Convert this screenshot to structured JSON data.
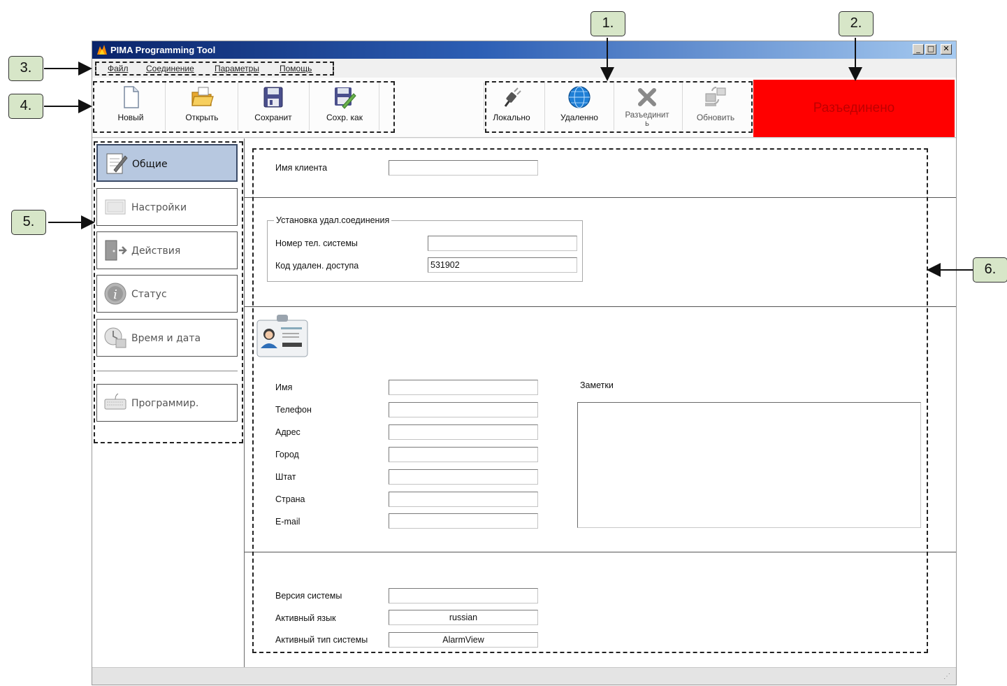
{
  "window": {
    "title": "PIMA Programming Tool",
    "controls": {
      "minimize": "_",
      "maximize": "□",
      "close": "✕"
    }
  },
  "menu": {
    "items": [
      "Файл",
      "Соединение",
      "Параметры",
      "Помощь"
    ]
  },
  "toolbar": {
    "file_buttons": [
      {
        "label": "Новый",
        "icon": "new-document-icon"
      },
      {
        "label": "Открыть",
        "icon": "open-folder-icon"
      },
      {
        "label": "Сохранит",
        "icon": "save-disk-icon"
      },
      {
        "label": "Сохр. как",
        "icon": "save-as-icon"
      }
    ],
    "connection_buttons": [
      {
        "label": "Локально",
        "icon": "plug-icon"
      },
      {
        "label": "Удаленно",
        "icon": "globe-icon"
      },
      {
        "label": "Разъединит\nь",
        "icon": "disconnect-x-icon"
      },
      {
        "label": "Обновить",
        "icon": "refresh-computer-icon"
      }
    ],
    "status": "Разъединено",
    "status_color": "#ff0000"
  },
  "sidebar": {
    "items": [
      {
        "label": "Общие",
        "icon": "notepad-pen-icon",
        "active": true
      },
      {
        "label": "Настройки",
        "icon": "settings-panel-icon",
        "active": false
      },
      {
        "label": "Действия",
        "icon": "door-exit-icon",
        "active": false
      },
      {
        "label": "Статус",
        "icon": "info-icon",
        "active": false
      },
      {
        "label": "Время и дата",
        "icon": "clock-calendar-icon",
        "active": false
      },
      {
        "label": "Программир.",
        "icon": "keyboard-icon",
        "active": false
      }
    ]
  },
  "main": {
    "client": {
      "label": "Имя клиента",
      "value": ""
    },
    "remote": {
      "group_title": "Установка удал.соединения",
      "phone_label": "Номер тел. системы",
      "phone_value": "",
      "code_label": "Код удален. доступа",
      "code_value": "531902"
    },
    "contact": {
      "fields": [
        {
          "label": "Имя",
          "value": ""
        },
        {
          "label": "Телефон",
          "value": ""
        },
        {
          "label": "Адрес",
          "value": ""
        },
        {
          "label": "Город",
          "value": ""
        },
        {
          "label": "Штат",
          "value": ""
        },
        {
          "label": "Страна",
          "value": ""
        },
        {
          "label": "E-mail",
          "value": ""
        }
      ],
      "notes_label": "Заметки",
      "notes_value": ""
    },
    "system": {
      "version_label": "Версия системы",
      "version_value": "",
      "language_label": "Активный язык",
      "language_value": "russian",
      "type_label": "Активный тип системы",
      "type_value": "AlarmView"
    }
  },
  "callouts": [
    "1.",
    "2.",
    "3.",
    "4.",
    "5.",
    "6."
  ]
}
